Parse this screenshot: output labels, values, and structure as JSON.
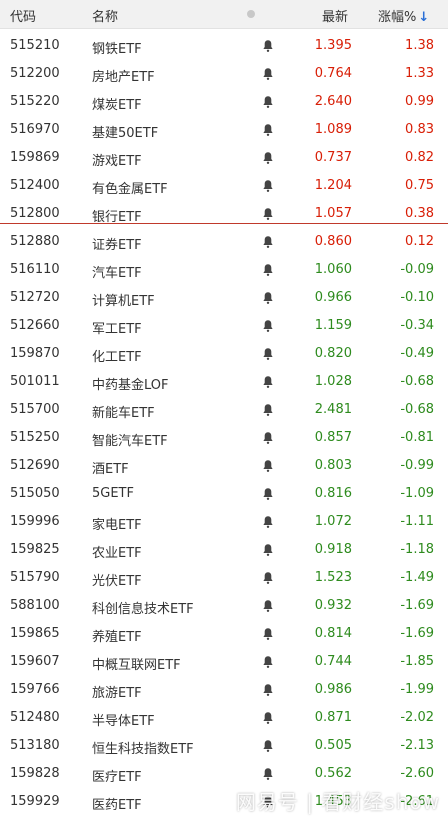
{
  "header": {
    "code_label": "代码",
    "name_label": "名称",
    "price_label": "最新",
    "change_label": "涨幅%",
    "sort_arrow": "↓"
  },
  "rows": [
    {
      "code": "515210",
      "name": "钢铁ETF",
      "price": "1.395",
      "change": "1.38",
      "trend": "up"
    },
    {
      "code": "512200",
      "name": "房地产ETF",
      "price": "0.764",
      "change": "1.33",
      "trend": "up"
    },
    {
      "code": "515220",
      "name": "煤炭ETF",
      "price": "2.640",
      "change": "0.99",
      "trend": "up"
    },
    {
      "code": "516970",
      "name": "基建50ETF",
      "price": "1.089",
      "change": "0.83",
      "trend": "up"
    },
    {
      "code": "159869",
      "name": "游戏ETF",
      "price": "0.737",
      "change": "0.82",
      "trend": "up"
    },
    {
      "code": "512400",
      "name": "有色金属ETF",
      "price": "1.204",
      "change": "0.75",
      "trend": "up"
    },
    {
      "code": "512800",
      "name": "银行ETF",
      "price": "1.057",
      "change": "0.38",
      "trend": "up"
    },
    {
      "code": "512880",
      "name": "证券ETF",
      "price": "0.860",
      "change": "0.12",
      "trend": "up"
    },
    {
      "code": "516110",
      "name": "汽车ETF",
      "price": "1.060",
      "change": "-0.09",
      "trend": "down"
    },
    {
      "code": "512720",
      "name": "计算机ETF",
      "price": "0.966",
      "change": "-0.10",
      "trend": "down"
    },
    {
      "code": "512660",
      "name": "军工ETF",
      "price": "1.159",
      "change": "-0.34",
      "trend": "down"
    },
    {
      "code": "159870",
      "name": "化工ETF",
      "price": "0.820",
      "change": "-0.49",
      "trend": "down"
    },
    {
      "code": "501011",
      "name": "中药基金LOF",
      "price": "1.028",
      "change": "-0.68",
      "trend": "down"
    },
    {
      "code": "515700",
      "name": "新能车ETF",
      "price": "2.481",
      "change": "-0.68",
      "trend": "down"
    },
    {
      "code": "515250",
      "name": "智能汽车ETF",
      "price": "0.857",
      "change": "-0.81",
      "trend": "down"
    },
    {
      "code": "512690",
      "name": "酒ETF",
      "price": "0.803",
      "change": "-0.99",
      "trend": "down"
    },
    {
      "code": "515050",
      "name": "5GETF",
      "price": "0.816",
      "change": "-1.09",
      "trend": "down"
    },
    {
      "code": "159996",
      "name": "家电ETF",
      "price": "1.072",
      "change": "-1.11",
      "trend": "down"
    },
    {
      "code": "159825",
      "name": "农业ETF",
      "price": "0.918",
      "change": "-1.18",
      "trend": "down"
    },
    {
      "code": "515790",
      "name": "光伏ETF",
      "price": "1.523",
      "change": "-1.49",
      "trend": "down"
    },
    {
      "code": "588100",
      "name": "科创信息技术ETF",
      "price": "0.932",
      "change": "-1.69",
      "trend": "down"
    },
    {
      "code": "159865",
      "name": "养殖ETF",
      "price": "0.814",
      "change": "-1.69",
      "trend": "down"
    },
    {
      "code": "159607",
      "name": "中概互联网ETF",
      "price": "0.744",
      "change": "-1.85",
      "trend": "down"
    },
    {
      "code": "159766",
      "name": "旅游ETF",
      "price": "0.986",
      "change": "-1.99",
      "trend": "down"
    },
    {
      "code": "512480",
      "name": "半导体ETF",
      "price": "0.871",
      "change": "-2.02",
      "trend": "down"
    },
    {
      "code": "513180",
      "name": "恒生科技指数ETF",
      "price": "0.505",
      "change": "-2.13",
      "trend": "down"
    },
    {
      "code": "159828",
      "name": "医疗ETF",
      "price": "0.562",
      "change": "-2.60",
      "trend": "down"
    },
    {
      "code": "159929",
      "name": "医药ETF",
      "price": "1.453",
      "change": "-2.61",
      "trend": "down"
    }
  ],
  "watermark": "网易号 | 看财经show",
  "colors": {
    "up": "#d81e06",
    "down": "#2e8b1e",
    "sort_arrow": "#2a6fd6"
  },
  "icons": {
    "row_icon": "bell-icon",
    "header_icon": "dot-icon"
  }
}
